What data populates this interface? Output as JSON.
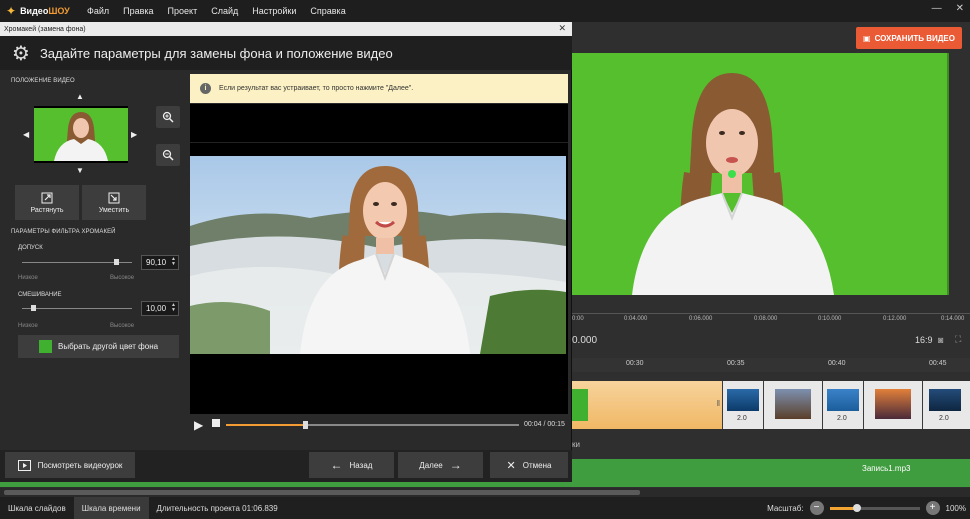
{
  "app": {
    "logo_text_1": "Видео",
    "logo_text_2": "ШОУ",
    "menu": [
      "Файл",
      "Правка",
      "Проект",
      "Слайд",
      "Настройки",
      "Справка"
    ],
    "save_button": "СОХРАНИТЬ ВИДЕО"
  },
  "dialog": {
    "window_title": "Хромакей (замена фона)",
    "header": "Задайте параметры для замены фона и положение видео",
    "position_section": "ПОЛОЖЕНИЕ ВИДЕО",
    "stretch_label": "Растянуть",
    "fit_label": "Уместить",
    "filter_section": "ПАРАМЕТРЫ ФИЛЬТРА ХРОМАКЕЙ",
    "tolerance_label": "ДОПУСК",
    "tolerance_value": "90,10",
    "tolerance_level": 0.85,
    "blend_label": "СМЕШИВАНИЕ",
    "blend_value": "10,00",
    "blend_level": 0.1,
    "low_label": "Низкое",
    "high_label": "Высокое",
    "color_button": "Выбрать другой цвет фона",
    "notice": "Если результат вас устраивает, то просто нажмите \"Далее\".",
    "player_time": "00:04 / 00:15",
    "player_progress": 0.27,
    "tutorial_button": "Посмотреть видеоурок",
    "back_button": "Назад",
    "next_button": "Далее",
    "cancel_button": "Отмена"
  },
  "editor": {
    "ruler_ticks": [
      "0:00",
      "0:04.000",
      "0:06.000",
      "0:08.000",
      "0:10.000",
      "0:12.000",
      "0:14.000"
    ],
    "timecode": "0.000",
    "aspect": "16:9",
    "timeline_ticks": [
      "00:30",
      "00:35",
      "00:40",
      "00:45"
    ],
    "clip_durations": [
      "2.0",
      "2.0",
      "2.0"
    ],
    "audio_label": "Запись1.mp3",
    "track_label": "ки"
  },
  "status": {
    "tab_slides": "Шкала слайдов",
    "tab_timeline": "Шкала времени",
    "duration": "Длительность проекта 01:06.839",
    "zoom_label": "Масштаб:",
    "zoom_value": "100%",
    "zoom_level": 0.3
  },
  "colors": {
    "accent": "#f39c33",
    "save": "#ea5a35",
    "chroma_green": "#55bf2e",
    "notice_bg": "#fcf1c4"
  }
}
